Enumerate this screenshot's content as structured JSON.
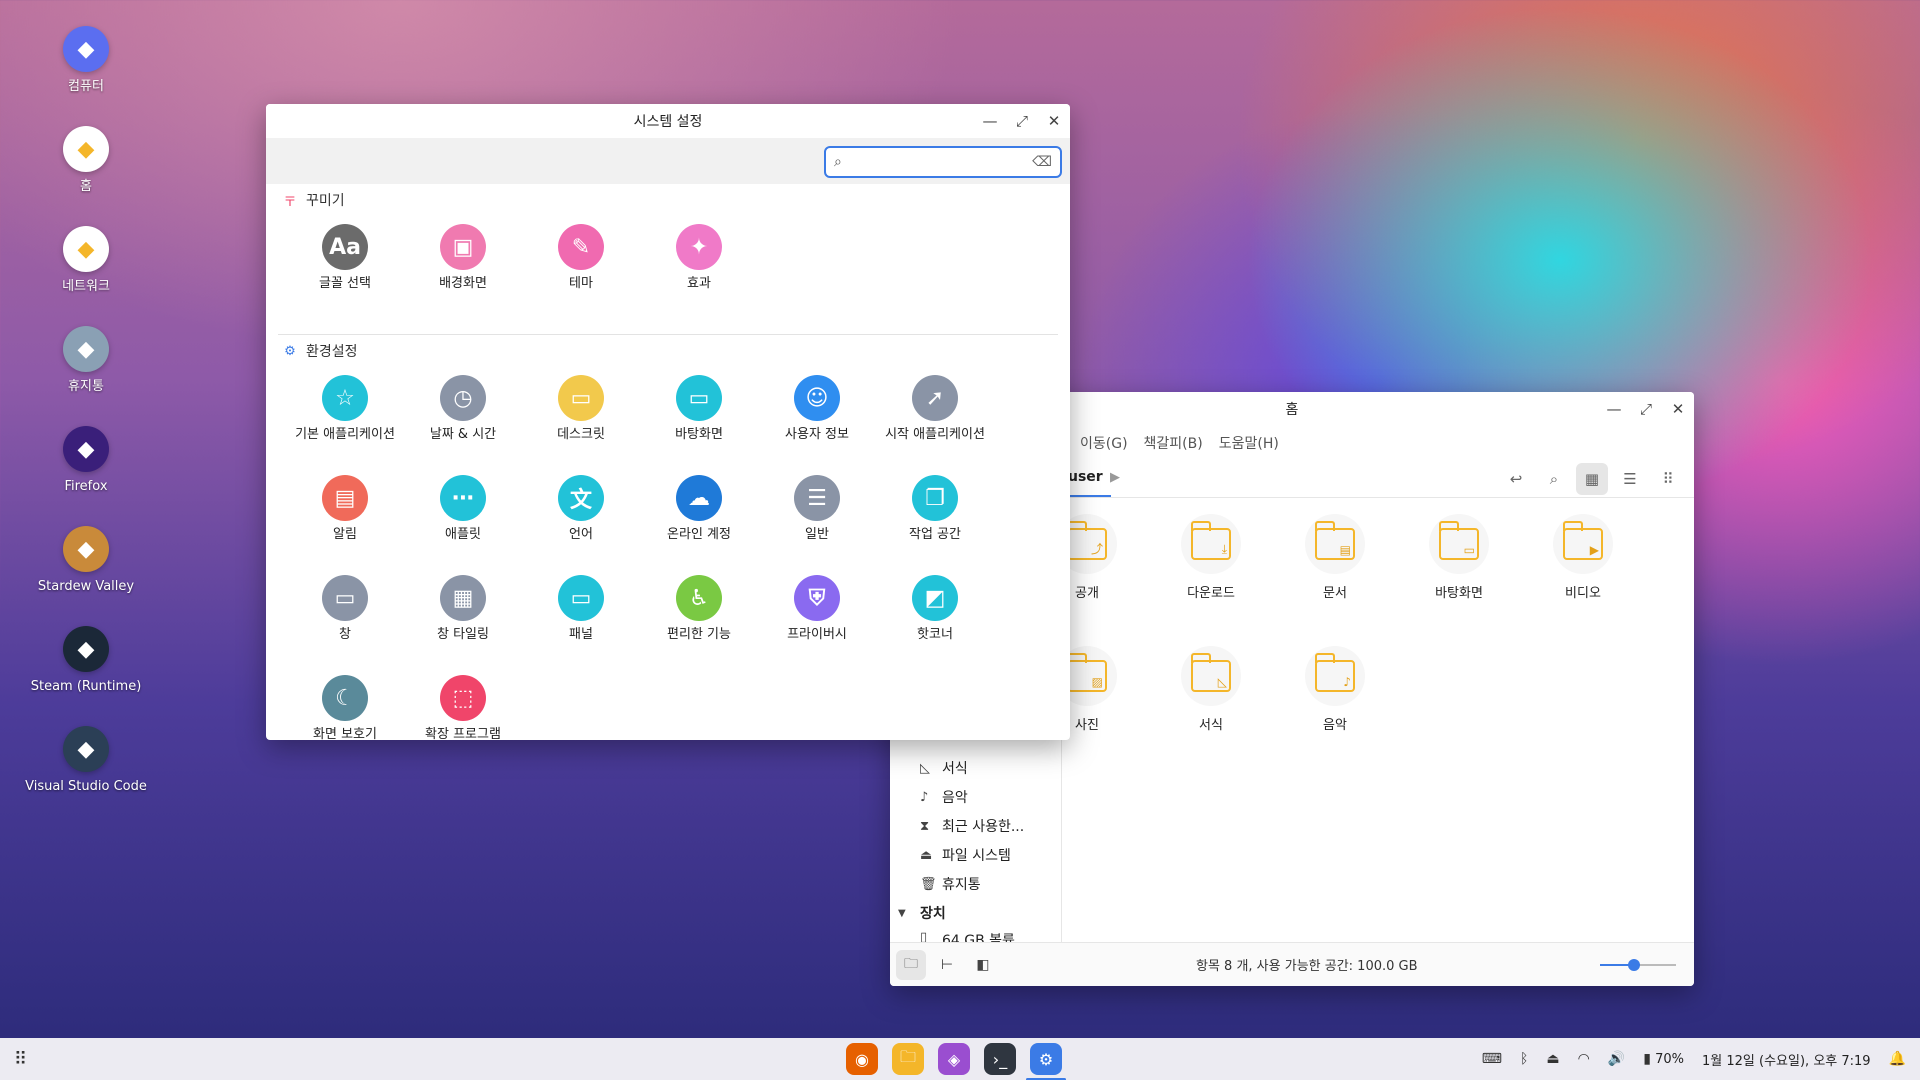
{
  "desktop": {
    "icons": [
      {
        "label": "컴퓨터",
        "icon": "computer-icon",
        "color": "#5b6ef0"
      },
      {
        "label": "홈",
        "icon": "home-folder-icon",
        "color": "#ffffff"
      },
      {
        "label": "네트워크",
        "icon": "network-folder-icon",
        "color": "#ffffff"
      },
      {
        "label": "휴지통",
        "icon": "trash-icon",
        "color": "#8aa0b4"
      },
      {
        "label": "Firefox",
        "icon": "firefox-icon",
        "color": "#3a1f7a"
      },
      {
        "label": "Stardew Valley",
        "icon": "stardew-valley-icon",
        "color": "#c98a3a"
      },
      {
        "label": "Steam (Runtime)",
        "icon": "steam-icon",
        "color": "#1b2838"
      },
      {
        "label": "Visual Studio Code",
        "icon": "vscode-icon",
        "color": "#2b3f56"
      }
    ]
  },
  "settings": {
    "title": "시스템 설정",
    "search_value": "",
    "sections": [
      {
        "title": "꾸미기",
        "icon": "paint-icon",
        "items": [
          {
            "label": "글꼴 선택",
            "icon": "font-icon",
            "color": "#6b6b6b",
            "glyph": "Aa"
          },
          {
            "label": "배경화면",
            "icon": "wallpaper-icon",
            "color": "#f07ab0",
            "glyph": "▣"
          },
          {
            "label": "테마",
            "icon": "theme-brush-icon",
            "color": "#f06ab0",
            "glyph": "✎"
          },
          {
            "label": "효과",
            "icon": "effects-wand-icon",
            "color": "#f07ac8",
            "glyph": "✦"
          }
        ]
      },
      {
        "title": "환경설정",
        "icon": "gear-icon",
        "items": [
          {
            "label": "기본 애플리케이션",
            "icon": "default-apps-icon",
            "color": "#22c2d8",
            "glyph": "☆"
          },
          {
            "label": "날짜 & 시간",
            "icon": "datetime-icon",
            "color": "#8a94a6",
            "glyph": "◷"
          },
          {
            "label": "데스크릿",
            "icon": "desklet-icon",
            "color": "#f2c94c",
            "glyph": "▭"
          },
          {
            "label": "바탕화면",
            "icon": "desktop-icon",
            "color": "#22c2d8",
            "glyph": "▭"
          },
          {
            "label": "사용자 정보",
            "icon": "user-info-icon",
            "color": "#2f8ef0",
            "glyph": "☺"
          },
          {
            "label": "시작 애플리케이션",
            "icon": "startup-apps-icon",
            "color": "#8a94a6",
            "glyph": "➚"
          },
          {
            "label": "알림",
            "icon": "notifications-icon",
            "color": "#f06a5a",
            "glyph": "▤"
          },
          {
            "label": "애플릿",
            "icon": "applets-icon",
            "color": "#22c2d8",
            "glyph": "⋯"
          },
          {
            "label": "언어",
            "icon": "language-icon",
            "color": "#22c2d8",
            "glyph": "文"
          },
          {
            "label": "온라인 계정",
            "icon": "online-accounts-icon",
            "color": "#1f7ad8",
            "glyph": "☁"
          },
          {
            "label": "일반",
            "icon": "general-sliders-icon",
            "color": "#8a94a6",
            "glyph": "☰"
          },
          {
            "label": "작업 공간",
            "icon": "workspaces-icon",
            "color": "#22c2d8",
            "glyph": "❐"
          },
          {
            "label": "창",
            "icon": "windows-icon",
            "color": "#8a94a6",
            "glyph": "▭"
          },
          {
            "label": "창 타일링",
            "icon": "window-tiling-icon",
            "color": "#8a94a6",
            "glyph": "▦"
          },
          {
            "label": "패널",
            "icon": "panel-icon",
            "color": "#22c2d8",
            "glyph": "▭"
          },
          {
            "label": "편리한 기능",
            "icon": "accessibility-icon",
            "color": "#7ac943",
            "glyph": "♿"
          },
          {
            "label": "프라이버시",
            "icon": "privacy-icon",
            "color": "#8a6af0",
            "glyph": "⛨"
          },
          {
            "label": "핫코너",
            "icon": "hot-corners-icon",
            "color": "#22c2d8",
            "glyph": "◩"
          },
          {
            "label": "화면 보호기",
            "icon": "screensaver-icon",
            "color": "#5a8a9a",
            "glyph": "☾"
          },
          {
            "label": "확장 프로그램",
            "icon": "extensions-icon",
            "color": "#f0456a",
            "glyph": "⬚"
          }
        ]
      }
    ]
  },
  "files": {
    "title": "홈",
    "menu": [
      "이동(G)",
      "책갈피(B)",
      "도움말(H)"
    ],
    "breadcrumb": "user",
    "sidebar": [
      {
        "label": "서식",
        "icon": "templates-icon"
      },
      {
        "label": "음악",
        "icon": "music-icon"
      },
      {
        "label": "최근 사용한...",
        "icon": "recent-icon"
      },
      {
        "label": "파일 시스템",
        "icon": "drive-icon"
      },
      {
        "label": "휴지통",
        "icon": "trash-icon"
      }
    ],
    "sidebar_section": "장치",
    "sidebar_device": "64 GB 볼륨",
    "folders": [
      {
        "label": "공개",
        "icon": "public-folder-icon",
        "glyph": "⤴"
      },
      {
        "label": "다운로드",
        "icon": "downloads-folder-icon",
        "glyph": "⤓"
      },
      {
        "label": "문서",
        "icon": "documents-folder-icon",
        "glyph": "▤"
      },
      {
        "label": "바탕화면",
        "icon": "desktop-folder-icon",
        "glyph": "▭"
      },
      {
        "label": "비디오",
        "icon": "videos-folder-icon",
        "glyph": "▶"
      },
      {
        "label": "사진",
        "icon": "pictures-folder-icon",
        "glyph": "▨"
      },
      {
        "label": "서식",
        "icon": "templates-folder-icon",
        "glyph": "◺"
      },
      {
        "label": "음악",
        "icon": "music-folder-icon",
        "glyph": "♪"
      }
    ],
    "status": "항목 8 개, 사용 가능한 공간: 100.0 GB",
    "zoom_level": 0.45
  },
  "taskbar": {
    "apps": [
      {
        "name": "firefox",
        "icon": "firefox-icon",
        "color": "#e66000"
      },
      {
        "name": "files",
        "icon": "files-icon",
        "color": "#f4b62a"
      },
      {
        "name": "software",
        "icon": "software-manager-icon",
        "color": "#9a4ed0"
      },
      {
        "name": "terminal",
        "icon": "terminal-icon",
        "color": "#2f3640"
      },
      {
        "name": "settings",
        "icon": "settings-icon",
        "color": "#3b7be6"
      }
    ],
    "battery": "70%",
    "clock": "1월 12일 (수요일), 오후 7:19"
  }
}
